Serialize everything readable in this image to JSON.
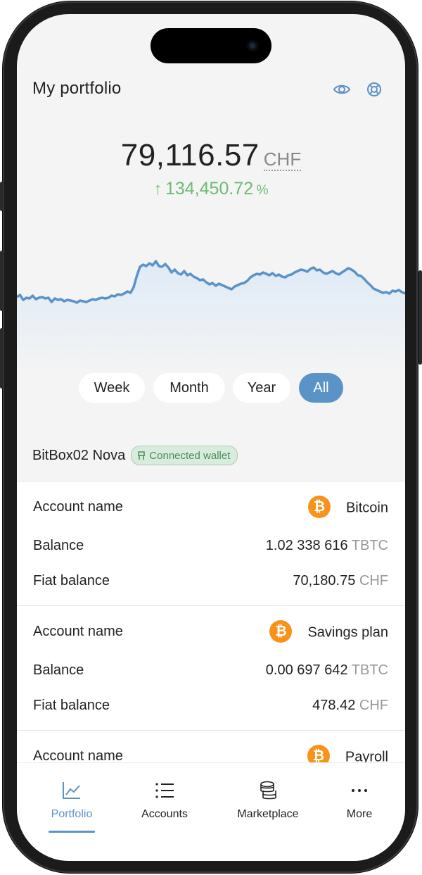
{
  "header": {
    "title": "My portfolio",
    "icons": [
      "eye-icon",
      "lifebuoy-icon"
    ]
  },
  "summary": {
    "amount": "79,116.57",
    "currency": "CHF",
    "change_arrow": "↑",
    "change_value": "134,450.72",
    "change_unit": "%"
  },
  "chart_data": {
    "type": "area",
    "series": [
      {
        "values": [
          0.28,
          0.31,
          0.24,
          0.27,
          0.26,
          0.3,
          0.25,
          0.27,
          0.28,
          0.26,
          0.27,
          0.21,
          0.26,
          0.24,
          0.25,
          0.22,
          0.24,
          0.23,
          0.22,
          0.2,
          0.23,
          0.22,
          0.21,
          0.23,
          0.25,
          0.24,
          0.26,
          0.27,
          0.26,
          0.27,
          0.3,
          0.29,
          0.32,
          0.31,
          0.33,
          0.36,
          0.34,
          0.42,
          0.58,
          0.71,
          0.74,
          0.72,
          0.76,
          0.73,
          0.79,
          0.72,
          0.71,
          0.75,
          0.7,
          0.63,
          0.67,
          0.62,
          0.6,
          0.65,
          0.59,
          0.61,
          0.57,
          0.55,
          0.52,
          0.53,
          0.49,
          0.46,
          0.48,
          0.44,
          0.47,
          0.45,
          0.43,
          0.41,
          0.39,
          0.43,
          0.45,
          0.47,
          0.48,
          0.51,
          0.56,
          0.59,
          0.61,
          0.6,
          0.63,
          0.61,
          0.59,
          0.62,
          0.58,
          0.6,
          0.57,
          0.56,
          0.59,
          0.6,
          0.63,
          0.65,
          0.67,
          0.66,
          0.64,
          0.68,
          0.7,
          0.66,
          0.67,
          0.63,
          0.61,
          0.63,
          0.65,
          0.62,
          0.6,
          0.63,
          0.66,
          0.69,
          0.67,
          0.64,
          0.59,
          0.58,
          0.54,
          0.49,
          0.45,
          0.4,
          0.38,
          0.36,
          0.34,
          0.35,
          0.33,
          0.37,
          0.36,
          0.38,
          0.35,
          0.33
        ]
      }
    ],
    "color": "#5b93c8",
    "fill": "#e7f0fa"
  },
  "timeframes": [
    "Week",
    "Month",
    "Year",
    "All"
  ],
  "timeframe_selected": "All",
  "wallet": {
    "name": "BitBox02 Nova",
    "badge": "Connected wallet"
  },
  "accounts": [
    {
      "label_name": "Account name",
      "name": "Bitcoin",
      "coin": "₿",
      "label_balance": "Balance",
      "balance": "1.02 338 616",
      "balance_unit": "TBTC",
      "label_fiat": "Fiat balance",
      "fiat": "70,180.75",
      "fiat_unit": "CHF"
    },
    {
      "label_name": "Account name",
      "name": "Savings plan",
      "coin": "₿",
      "label_balance": "Balance",
      "balance": "0.00 697 642",
      "balance_unit": "TBTC",
      "label_fiat": "Fiat balance",
      "fiat": "478.42",
      "fiat_unit": "CHF"
    },
    {
      "label_name": "Account name",
      "name": "Payroll",
      "coin": "₿"
    }
  ],
  "tabs": [
    {
      "label": "Portfolio",
      "icon": "chart-line-icon"
    },
    {
      "label": "Accounts",
      "icon": "list-icon"
    },
    {
      "label": "Marketplace",
      "icon": "coins-icon"
    },
    {
      "label": "More",
      "icon": "dots-icon"
    }
  ],
  "tab_selected": "Portfolio"
}
